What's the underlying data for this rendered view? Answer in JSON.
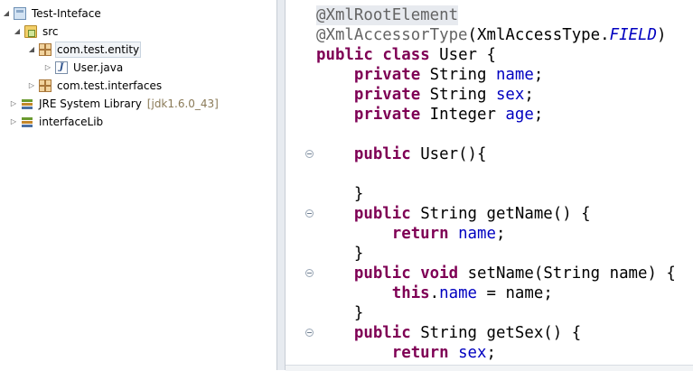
{
  "tree": {
    "items": [
      {
        "label": "Test-Inteface",
        "icon": "project-icon",
        "toggle": "expanded"
      },
      {
        "label": "src",
        "icon": "source-folder-icon",
        "toggle": "expanded"
      },
      {
        "label": "com.test.entity",
        "icon": "package-icon",
        "toggle": "expanded"
      },
      {
        "label": "User.java",
        "icon": "java-file-icon",
        "toggle": "collapsed"
      },
      {
        "label": "com.test.interfaces",
        "icon": "package-icon",
        "toggle": "collapsed"
      },
      {
        "label": "JRE System Library",
        "suffix": "[jdk1.6.0_43]",
        "icon": "library-icon",
        "toggle": "collapsed"
      },
      {
        "label": "interfaceLib",
        "icon": "library-icon",
        "toggle": "collapsed"
      }
    ]
  },
  "editor": {
    "lines": [
      [
        {
          "t": "@XmlRootElement",
          "c": "ann"
        }
      ],
      [
        {
          "t": "@XmlAccessorType",
          "c": "ann"
        },
        {
          "t": "(XmlAccessType.",
          "c": ""
        },
        {
          "t": "FIELD",
          "c": "ital"
        },
        {
          "t": ")",
          "c": ""
        }
      ],
      [
        {
          "t": "public",
          "c": "kw"
        },
        {
          "t": " ",
          "c": ""
        },
        {
          "t": "class",
          "c": "kw"
        },
        {
          "t": " User {",
          "c": ""
        }
      ],
      [
        {
          "t": "    ",
          "c": ""
        },
        {
          "t": "private",
          "c": "kw"
        },
        {
          "t": " String ",
          "c": ""
        },
        {
          "t": "name",
          "c": "fld"
        },
        {
          "t": ";",
          "c": ""
        }
      ],
      [
        {
          "t": "    ",
          "c": ""
        },
        {
          "t": "private",
          "c": "kw"
        },
        {
          "t": " String ",
          "c": ""
        },
        {
          "t": "sex",
          "c": "fld"
        },
        {
          "t": ";",
          "c": ""
        }
      ],
      [
        {
          "t": "    ",
          "c": ""
        },
        {
          "t": "private",
          "c": "kw"
        },
        {
          "t": " Integer ",
          "c": ""
        },
        {
          "t": "age",
          "c": "fld"
        },
        {
          "t": ";",
          "c": ""
        }
      ],
      [],
      [
        {
          "t": "    ",
          "c": ""
        },
        {
          "t": "public",
          "c": "kw"
        },
        {
          "t": " User(){",
          "c": ""
        }
      ],
      [],
      [
        {
          "t": "    }",
          "c": ""
        }
      ],
      [
        {
          "t": "    ",
          "c": ""
        },
        {
          "t": "public",
          "c": "kw"
        },
        {
          "t": " String getName() {",
          "c": ""
        }
      ],
      [
        {
          "t": "        ",
          "c": ""
        },
        {
          "t": "return",
          "c": "kw"
        },
        {
          "t": " ",
          "c": ""
        },
        {
          "t": "name",
          "c": "fld"
        },
        {
          "t": ";",
          "c": ""
        }
      ],
      [
        {
          "t": "    }",
          "c": ""
        }
      ],
      [
        {
          "t": "    ",
          "c": ""
        },
        {
          "t": "public",
          "c": "kw"
        },
        {
          "t": " ",
          "c": ""
        },
        {
          "t": "void",
          "c": "kw"
        },
        {
          "t": " setName(String name) {",
          "c": ""
        }
      ],
      [
        {
          "t": "        ",
          "c": ""
        },
        {
          "t": "this",
          "c": "kw"
        },
        {
          "t": ".",
          "c": ""
        },
        {
          "t": "name",
          "c": "fld"
        },
        {
          "t": " = name;",
          "c": ""
        }
      ],
      [
        {
          "t": "    }",
          "c": ""
        }
      ],
      [
        {
          "t": "    ",
          "c": ""
        },
        {
          "t": "public",
          "c": "kw"
        },
        {
          "t": " String getSex() {",
          "c": ""
        }
      ],
      [
        {
          "t": "        ",
          "c": ""
        },
        {
          "t": "return",
          "c": "kw"
        },
        {
          "t": " ",
          "c": ""
        },
        {
          "t": "sex",
          "c": "fld"
        },
        {
          "t": ";",
          "c": ""
        }
      ]
    ],
    "fold_marker_lines": [
      7,
      10,
      13,
      16
    ]
  },
  "colors": {
    "keyword": "#7f0055",
    "field": "#0000c0",
    "annotation": "#646464"
  }
}
